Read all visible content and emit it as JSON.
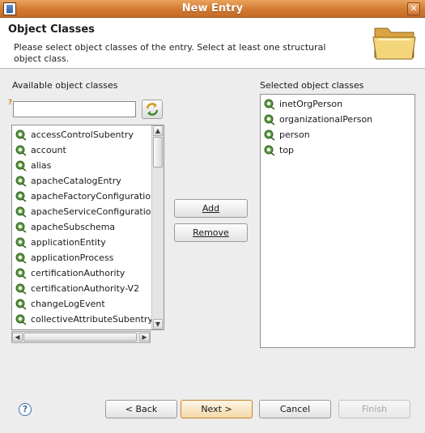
{
  "window": {
    "title": "New Entry"
  },
  "banner": {
    "heading": "Object Classes",
    "description": "Please select object classes of the entry. Select at least one structural object class."
  },
  "available": {
    "label": "Available object classes",
    "filter_value": "",
    "items": [
      "accessControlSubentry",
      "account",
      "alias",
      "apacheCatalogEntry",
      "apacheFactoryConfiguration",
      "apacheServiceConfiguration",
      "apacheSubschema",
      "applicationEntity",
      "applicationProcess",
      "certificationAuthority",
      "certificationAuthority-V2",
      "changeLogEvent",
      "collectiveAttributeSubentry"
    ]
  },
  "selected": {
    "label": "Selected object classes",
    "items": [
      "inetOrgPerson",
      "organizationalPerson",
      "person",
      "top"
    ]
  },
  "buttons": {
    "add": "Add",
    "remove": "Remove",
    "back": "< Back",
    "next": "Next >",
    "cancel": "Cancel",
    "finish": "Finish"
  },
  "icons": {
    "help": "help-icon",
    "object_class": "object-class-icon",
    "folder": "folder-icon",
    "refresh": "refresh-icon"
  }
}
